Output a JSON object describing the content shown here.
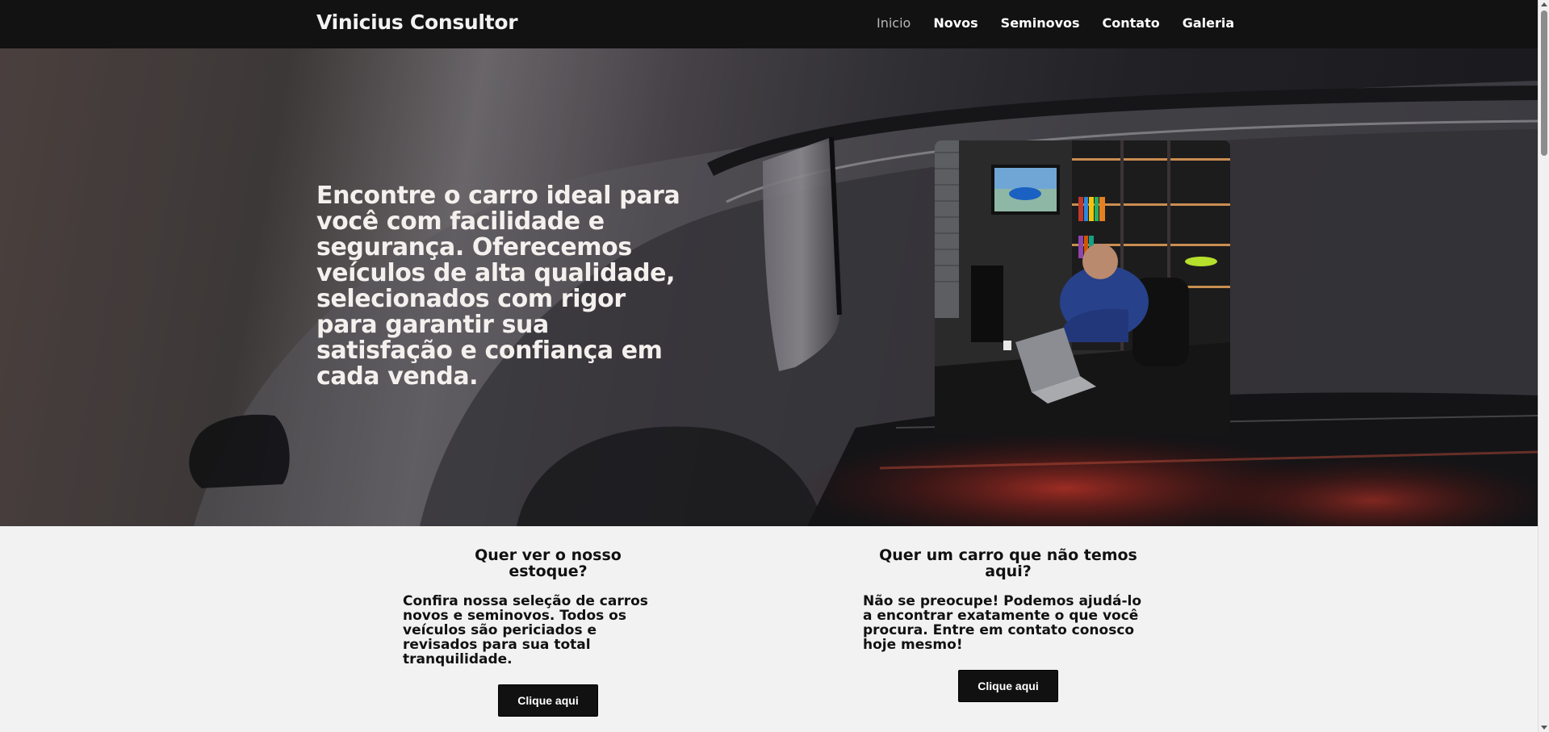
{
  "header": {
    "brand": "Vinicius Consultor",
    "nav": [
      "Inicio",
      "Novos",
      "Seminovos",
      "Contato",
      "Galeria"
    ]
  },
  "hero": {
    "title": "Encontre o carro ideal para você com facilidade e segurança. Oferecemos veículos de alta qualidade, selecionados com rigor para garantir sua satisfação e confiança em cada venda."
  },
  "cards": [
    {
      "title": "Quer ver o nosso estoque?",
      "text": "Confira nossa seleção de carros novos e seminovos. Todos os veículos são periciados e revisados para sua total tranquilidade.",
      "button": "Clique aqui"
    },
    {
      "title": "Quer um carro que não temos aqui?",
      "text": "Não se preocupe! Podemos ajudá-lo a encontrar exatamente o que você procura. Entre em contato conosco hoje mesmo!",
      "button": "Clique aqui"
    }
  ],
  "colors": {
    "navbar": "#121212",
    "button": "#111111",
    "section_bg": "#f2f2f2"
  },
  "icons": [
    "chevron-up-icon",
    "chevron-down-icon"
  ]
}
